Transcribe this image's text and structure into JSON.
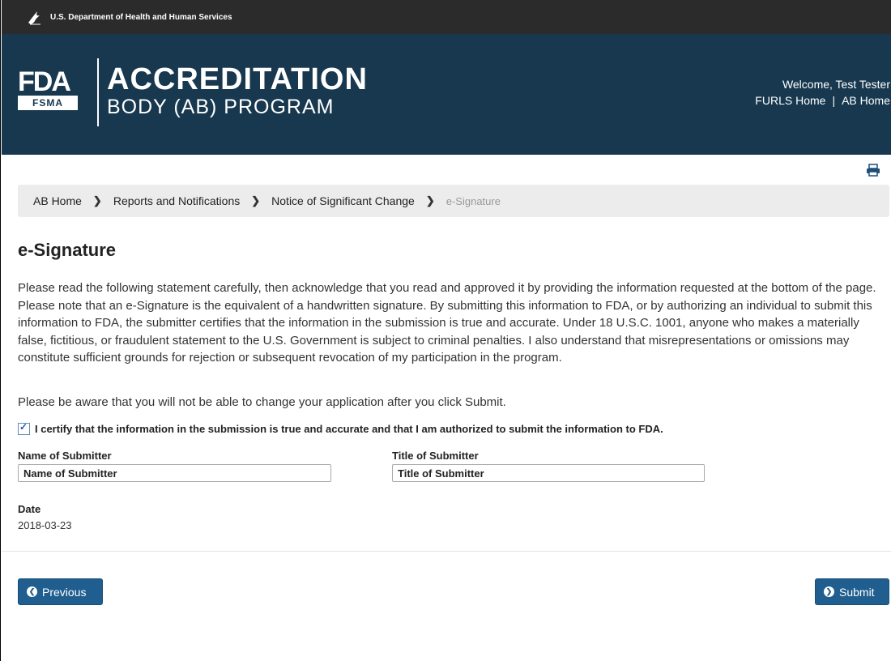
{
  "hhs_bar": {
    "text": "U.S. Department of Health and Human Services",
    "icon": "hhs-eagle-icon"
  },
  "header": {
    "logo_fda": "FDA",
    "logo_fsma": "FSMA",
    "title_line1": "ACCREDITATION",
    "title_line2": "BODY (AB) PROGRAM",
    "welcome": "Welcome, Test Tester",
    "links": [
      "FURLS Home",
      "AB Home"
    ],
    "link_separator": "|"
  },
  "print_icon": "print-icon",
  "breadcrumb": {
    "items": [
      "AB Home",
      "Reports and Notifications",
      "Notice of Significant Change"
    ],
    "current": "e-Signature",
    "separator": ">"
  },
  "page": {
    "title": "e-Signature",
    "statement": "Please read the following statement carefully, then acknowledge that you read and approved it by providing the information requested at the bottom of the page. Please note that an e-Signature is the equivalent of a handwritten signature. By submitting this information to FDA, or by authorizing an individual to submit this information to FDA, the submitter certifies that the information in the submission is true and accurate. Under 18 U.S.C. 1001, anyone who makes a materially false, fictitious, or fraudulent statement to the U.S. Government is subject to criminal penalties. I also understand that misrepresentations or omissions may constitute sufficient grounds for rejection or subsequent revocation of my participation in the program.",
    "aware": "Please be aware that you will not be able to change your application after you click Submit.",
    "certify_label": "I certify that the information in the submission is true and accurate and that I am authorized to submit the information to FDA.",
    "certify_checked": true
  },
  "form": {
    "name_label": "Name of Submitter",
    "name_placeholder": "Name of Submitter",
    "title_label": "Title of Submitter",
    "title_placeholder": "Title of Submitter",
    "date_label": "Date",
    "date_value": "2018-03-23"
  },
  "buttons": {
    "previous": "Previous",
    "submit": "Submit"
  },
  "colors": {
    "hhs_bar": "#2b2b2b",
    "header": "#17384f",
    "button": "#205e8f",
    "breadcrumb_bg": "#ececec"
  }
}
